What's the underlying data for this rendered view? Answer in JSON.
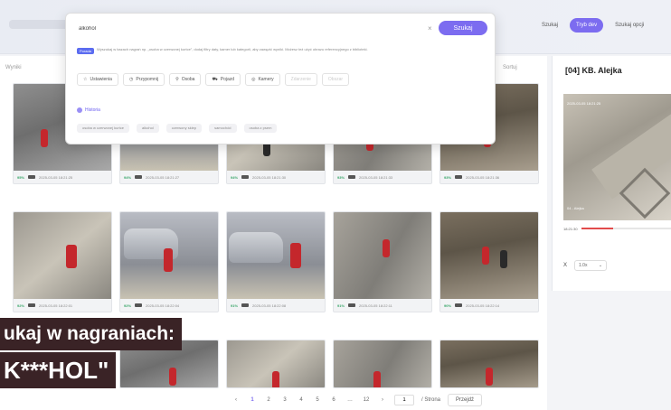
{
  "header": {
    "modes": [
      "Szukaj",
      "Tryb dev",
      "Szukaj opcji"
    ]
  },
  "search": {
    "query": "alkohol",
    "button_label": "Szukaj",
    "badge": "Porada",
    "hint": "Wyszukaj w bazach nagrań np. „osoba w czerwonej kurtce”, dodaj filtry daty, kamer lub kategorii, aby zawęzić wyniki. Możesz też użyć obrazu referencyjnego z biblioteki.",
    "filters": [
      "Ustawienia",
      "Przypomnij",
      "Osoba",
      "Pojazd",
      "Kamery",
      "Zdarzenie",
      "Obszar"
    ],
    "history_label": "Historia",
    "history_items": [
      "osoba w czerwonej kurtce",
      "alkohol",
      "czerwony sklep",
      "samochód",
      "osoba z psem"
    ]
  },
  "results": {
    "left_label": "Wyniki",
    "right_label": "Sortuj",
    "tiles": [
      {
        "score": "95%",
        "time": "2025-03-05 18:21:25"
      },
      {
        "score": "94%",
        "time": "2025-03-05 18:21:27"
      },
      {
        "score": "94%",
        "time": "2025-03-05 18:21:30"
      },
      {
        "score": "93%",
        "time": "2025-03-05 18:21:33"
      },
      {
        "score": "93%",
        "time": "2025-03-05 18:21:36"
      },
      {
        "score": "92%",
        "time": "2025-03-05 18:22:01"
      },
      {
        "score": "92%",
        "time": "2025-03-05 18:22:04"
      },
      {
        "score": "91%",
        "time": "2025-03-05 18:22:08"
      },
      {
        "score": "91%",
        "time": "2025-03-05 18:22:11"
      },
      {
        "score": "90%",
        "time": "2025-03-05 18:22:14"
      }
    ]
  },
  "caption": {
    "line1": "ukaj w nagraniach:",
    "line2": "K***HOL\""
  },
  "pagination": {
    "prev": "‹",
    "pages": [
      "1",
      "2",
      "3",
      "4",
      "5",
      "6",
      "…",
      "12"
    ],
    "next": "›",
    "current_page": "1",
    "per_page": "/ Strona",
    "goto_label": "Przejdź"
  },
  "camera": {
    "title": "[04] KB. Alejka",
    "overlay_top": "2025-03-05 18:21:25",
    "overlay_bottom": "04 - Alejka",
    "time": "18:21:30",
    "progress_fraction": 0.35,
    "speed_label": "X",
    "speed_value": "1.0x"
  }
}
